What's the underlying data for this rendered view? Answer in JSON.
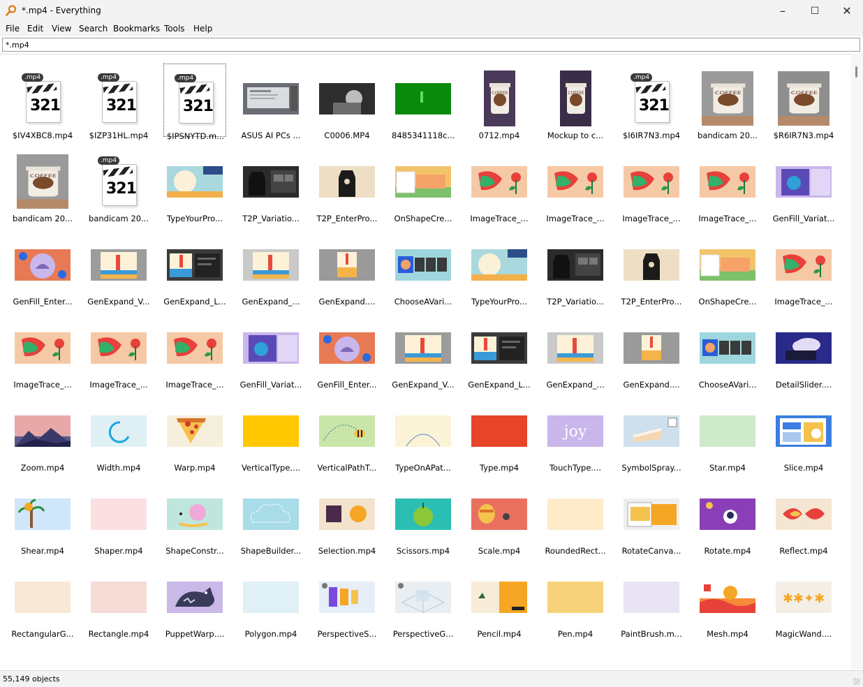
{
  "window": {
    "title": "*.mp4 - Everything",
    "controls": [
      "–",
      "☐",
      "✕"
    ]
  },
  "menu": [
    "File",
    "Edit",
    "View",
    "Search",
    "Bookmarks",
    "Tools",
    "Help"
  ],
  "search": {
    "value": "*.mp4"
  },
  "status": {
    "text": "55,149 objects"
  },
  "badge_text": ".mp4",
  "mp4_icon_number": "321",
  "rows": [
    [
      {
        "label": "$IV4XBC8.mp4",
        "thumb": "mp4-icon"
      },
      {
        "label": "$IZP31HL.mp4",
        "thumb": "mp4-icon"
      },
      {
        "label": "$IPSNYTD.m...",
        "thumb": "mp4-icon",
        "selected": true
      },
      {
        "label": "ASUS AI PCs ...",
        "thumb": "screen",
        "bg": "#6a6e74"
      },
      {
        "label": "C0006.MP4",
        "thumb": "photo",
        "bg": "#3c3c3c"
      },
      {
        "label": "8485341118c...",
        "thumb": "green",
        "bg": "#0a8a0a"
      },
      {
        "label": "0712.mp4",
        "thumb": "cup-portrait",
        "bg": "#4a3a5a"
      },
      {
        "label": "Mockup to c...",
        "thumb": "cup-portrait",
        "bg": "#3a2d48"
      },
      {
        "label": "$I6IR7N3.mp4",
        "thumb": "mp4-icon"
      },
      {
        "label": "bandicam 20...",
        "thumb": "cup-square",
        "bg": "#9a9a9a"
      },
      {
        "label": "$R6IR7N3.mp4",
        "thumb": "cup-square",
        "bg": "#8e8e8e"
      }
    ],
    [
      {
        "label": "bandicam 20...",
        "thumb": "cup-square",
        "bg": "#9a9a9a"
      },
      {
        "label": "bandicam 20...",
        "thumb": "mp4-icon"
      },
      {
        "label": "TypeYourPro...",
        "thumb": "sun",
        "bg": "#a9d9de"
      },
      {
        "label": "T2P_Variatio...",
        "thumb": "apron-dark",
        "bg": "#2b2b2b"
      },
      {
        "label": "T2P_EnterPro...",
        "thumb": "apron",
        "bg": "#eedfc4"
      },
      {
        "label": "OnShapeCre...",
        "thumb": "house",
        "bg": "#f2c46a"
      },
      {
        "label": "ImageTrace_...",
        "thumb": "bird",
        "bg": "#f6c9a6"
      },
      {
        "label": "ImageTrace_...",
        "thumb": "bird",
        "bg": "#f6c9a6"
      },
      {
        "label": "ImageTrace_...",
        "thumb": "bird",
        "bg": "#f6c9a6"
      },
      {
        "label": "ImageTrace_...",
        "thumb": "bird",
        "bg": "#f6c9a6"
      },
      {
        "label": "GenFill_Variat...",
        "thumb": "purple",
        "bg": "#c9b6ea"
      }
    ],
    [
      {
        "label": "GenFill_Enter...",
        "thumb": "pattern",
        "bg": "#e77a55"
      },
      {
        "label": "GenExpand_V...",
        "thumb": "lighthouse",
        "bg": "#9c9c9c"
      },
      {
        "label": "GenExpand_L...",
        "thumb": "lighthouse-dark",
        "bg": "#3b3b3b"
      },
      {
        "label": "GenExpand_...",
        "thumb": "lighthouse",
        "bg": "#c9c9c9"
      },
      {
        "label": "GenExpand....",
        "thumb": "lighthouse-small",
        "bg": "#9a9a9a"
      },
      {
        "label": "ChooseAVari...",
        "thumb": "strip",
        "bg": "#9fd6dd"
      },
      {
        "label": "TypeYourPro...",
        "thumb": "sun",
        "bg": "#a9d9de"
      },
      {
        "label": "T2P_Variatio...",
        "thumb": "apron-dark",
        "bg": "#2b2b2b"
      },
      {
        "label": "T2P_EnterPro...",
        "thumb": "apron",
        "bg": "#eedfc4"
      },
      {
        "label": "OnShapeCre...",
        "thumb": "house",
        "bg": "#f2c46a"
      },
      {
        "label": "ImageTrace_...",
        "thumb": "bird",
        "bg": "#f6c9a6"
      }
    ],
    [
      {
        "label": "ImageTrace_...",
        "thumb": "bird",
        "bg": "#f6c9a6"
      },
      {
        "label": "ImageTrace_...",
        "thumb": "bird",
        "bg": "#f6c9a6"
      },
      {
        "label": "ImageTrace_...",
        "thumb": "bird",
        "bg": "#f6c9a6"
      },
      {
        "label": "GenFill_Variat...",
        "thumb": "purple",
        "bg": "#c9b6ea"
      },
      {
        "label": "GenFill_Enter...",
        "thumb": "pattern",
        "bg": "#e77a55"
      },
      {
        "label": "GenExpand_V...",
        "thumb": "lighthouse",
        "bg": "#9c9c9c"
      },
      {
        "label": "GenExpand_L...",
        "thumb": "lighthouse-dark",
        "bg": "#3b3b3b"
      },
      {
        "label": "GenExpand_...",
        "thumb": "lighthouse",
        "bg": "#c9c9c9"
      },
      {
        "label": "GenExpand....",
        "thumb": "lighthouse-small",
        "bg": "#9a9a9a"
      },
      {
        "label": "ChooseAVari...",
        "thumb": "strip",
        "bg": "#9fd6dd"
      },
      {
        "label": "DetailSlider....",
        "thumb": "cloud",
        "bg": "#2a2a8a"
      }
    ],
    [
      {
        "label": "Zoom.mp4",
        "thumb": "mountain",
        "bg": "#5b5a8a"
      },
      {
        "label": "Width.mp4",
        "thumb": "ring",
        "bg": "#dff0f4"
      },
      {
        "label": "Warp.mp4",
        "thumb": "pizza",
        "bg": "#f6efdc"
      },
      {
        "label": "VerticalType....",
        "thumb": "plain",
        "bg": "#ffc800"
      },
      {
        "label": "VerticalPathT...",
        "thumb": "bee",
        "bg": "#c9e6a8"
      },
      {
        "label": "TypeOnAPat...",
        "thumb": "arc",
        "bg": "#fbf3d6"
      },
      {
        "label": "Type.mp4",
        "thumb": "plain",
        "bg": "#e8442a"
      },
      {
        "label": "TouchType....",
        "thumb": "joy",
        "bg": "#c9b6ea"
      },
      {
        "label": "SymbolSpray...",
        "thumb": "cake",
        "bg": "#cde0ec"
      },
      {
        "label": "Star.mp4",
        "thumb": "plain",
        "bg": "#cfeacb"
      },
      {
        "label": "Slice.mp4",
        "thumb": "slice",
        "bg": "#3b7de0"
      }
    ],
    [
      {
        "label": "Shear.mp4",
        "thumb": "palm",
        "bg": "#cfe6fb"
      },
      {
        "label": "Shaper.mp4",
        "thumb": "plain",
        "bg": "#fbe0e2"
      },
      {
        "label": "ShapeConstr...",
        "thumb": "snail",
        "bg": "#bfe6dc"
      },
      {
        "label": "ShapeBuilder...",
        "thumb": "cloud-outline",
        "bg": "#a8dce8"
      },
      {
        "label": "Selection.mp4",
        "thumb": "selection",
        "bg": "#f3e2cc"
      },
      {
        "label": "Scissors.mp4",
        "thumb": "apple",
        "bg": "#2bbfb4"
      },
      {
        "label": "Scale.mp4",
        "thumb": "scale",
        "bg": "#e9705e"
      },
      {
        "label": "RoundedRect...",
        "thumb": "plain",
        "bg": "#fdebc9"
      },
      {
        "label": "RotateCanva...",
        "thumb": "rotatecanvas",
        "bg": "#efefef"
      },
      {
        "label": "Rotate.mp4",
        "thumb": "astronaut",
        "bg": "#8a3fb8"
      },
      {
        "label": "Reflect.mp4",
        "thumb": "reflect",
        "bg": "#f5e6d3"
      }
    ],
    [
      {
        "label": "RectangularG...",
        "thumb": "plain",
        "bg": "#f7e9d6"
      },
      {
        "label": "Rectangle.mp4",
        "thumb": "plain",
        "bg": "#f5dcd6"
      },
      {
        "label": "PuppetWarp....",
        "thumb": "wolf",
        "bg": "#c9b8e8"
      },
      {
        "label": "Polygon.mp4",
        "thumb": "plain",
        "bg": "#dff0f6"
      },
      {
        "label": "PerspectiveS...",
        "thumb": "perspective",
        "bg": "#e6eef8"
      },
      {
        "label": "PerspectiveG...",
        "thumb": "grid3d",
        "bg": "#e9eef2"
      },
      {
        "label": "Pencil.mp4",
        "thumb": "pencil",
        "bg": "#f5c24e"
      },
      {
        "label": "Pen.mp4",
        "thumb": "plain",
        "bg": "#f7d27a"
      },
      {
        "label": "PaintBrush.m...",
        "thumb": "plain",
        "bg": "#e8e4f4"
      },
      {
        "label": "Mesh.mp4",
        "thumb": "mesh",
        "bg": "#f58a3a"
      },
      {
        "label": "MagicWand....",
        "thumb": "magic",
        "bg": "#f4efe6"
      }
    ]
  ]
}
